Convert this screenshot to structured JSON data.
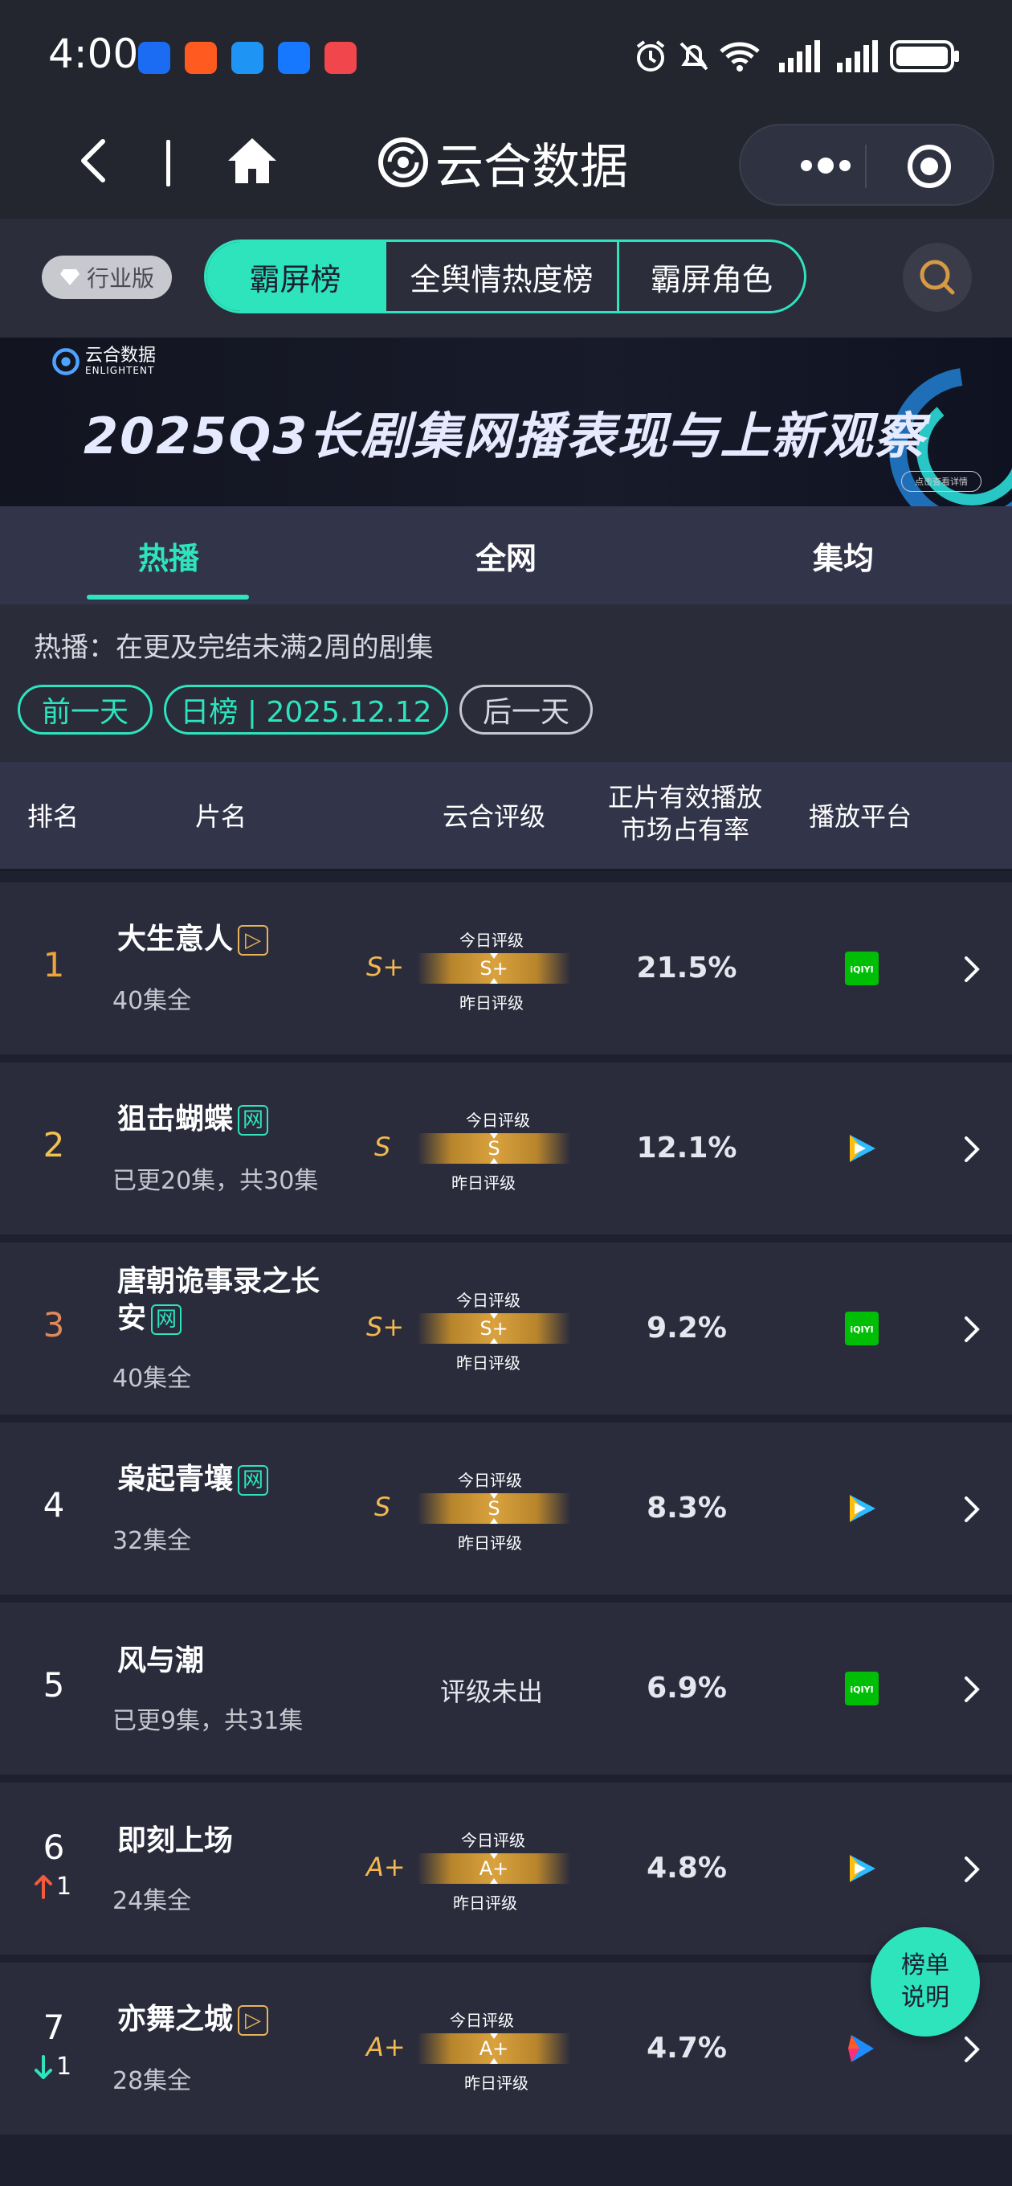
{
  "status_bar": {
    "time": "4:00",
    "icons": [
      "alarm-icon",
      "mute-bell-icon",
      "wifi-icon",
      "signal-icon",
      "signal-icon",
      "battery-icon"
    ],
    "apps": [
      "taobao-app-icon",
      "chat-app-icon",
      "alipay-app-icon",
      "notes-app-icon"
    ]
  },
  "nav": {
    "brand": "云合数据",
    "more_icon": "more-dots-icon",
    "close_icon": "target-close-icon"
  },
  "header": {
    "industry_label": "行业版",
    "tabs": [
      "霸屏榜",
      "全舆情热度榜",
      "霸屏角色"
    ],
    "active_tab": 0
  },
  "banner": {
    "logo_cn": "云合数据",
    "logo_en": "ENLIGHTENT",
    "title": "2025Q3长剧集网播表现与上新观察",
    "button": "点击查看详情"
  },
  "subtabs": [
    "热播",
    "全网",
    "集均"
  ],
  "info": {
    "text": "热播：在更及完结未满2周的剧集",
    "prev_day": "前一天",
    "date_label": "日榜 | 2025.12.12",
    "next_day": "后一天"
  },
  "table_header": {
    "rank": "排名",
    "title": "片名",
    "grade": "云合评级",
    "share_line1": "正片有效播放",
    "share_line2": "市场占有率",
    "platform": "播放平台"
  },
  "rating_labels": {
    "today": "今日评级",
    "yesterday": "昨日评级"
  },
  "rows": [
    {
      "rank": "1",
      "title": "大生意人",
      "tag": "play",
      "sub": "40集全",
      "grade": "S+",
      "share": "21.5%",
      "platform": "iqiyi",
      "trend": ""
    },
    {
      "rank": "2",
      "title": "狙击蝴蝶",
      "tag": "net",
      "tag_text": "网",
      "sub": "已更20集，共30集",
      "grade": "S",
      "share": "12.1%",
      "platform": "tencent",
      "trend": ""
    },
    {
      "rank": "3",
      "title_line1": "唐朝诡事录之长",
      "title_line2": "安",
      "tag": "net",
      "tag_text": "网",
      "sub": "40集全",
      "grade": "S+",
      "share": "9.2%",
      "platform": "iqiyi",
      "trend": ""
    },
    {
      "rank": "4",
      "title": "枭起青壤",
      "tag": "net",
      "tag_text": "网",
      "sub": "32集全",
      "grade": "S",
      "share": "8.3%",
      "platform": "tencent",
      "trend": ""
    },
    {
      "rank": "5",
      "title": "风与潮",
      "sub": "已更9集，共31集",
      "no_grade": "评级未出",
      "share": "6.9%",
      "platform": "iqiyi",
      "trend": ""
    },
    {
      "rank": "6",
      "title": "即刻上场",
      "sub": "24集全",
      "grade": "A+",
      "share": "4.8%",
      "platform": "tencent",
      "trend": "up",
      "trend_value": "1"
    },
    {
      "rank": "7",
      "title": "亦舞之城",
      "tag": "play",
      "sub": "28集全",
      "grade": "A+",
      "share": "4.7%",
      "platform": "youku",
      "trend": "down",
      "trend_value": "1"
    }
  ],
  "float_button": {
    "line1": "榜单",
    "line2": "说明"
  },
  "colors": {
    "accent": "#2de4bd",
    "gold": "#f2b851",
    "rank_1": "#f0a33c",
    "rank_2": "#f2c14f",
    "rank_3": "#e0885a",
    "trend_up": "#f25b3c",
    "trend_down": "#2de4bd",
    "iqiyi": "#00be06"
  }
}
